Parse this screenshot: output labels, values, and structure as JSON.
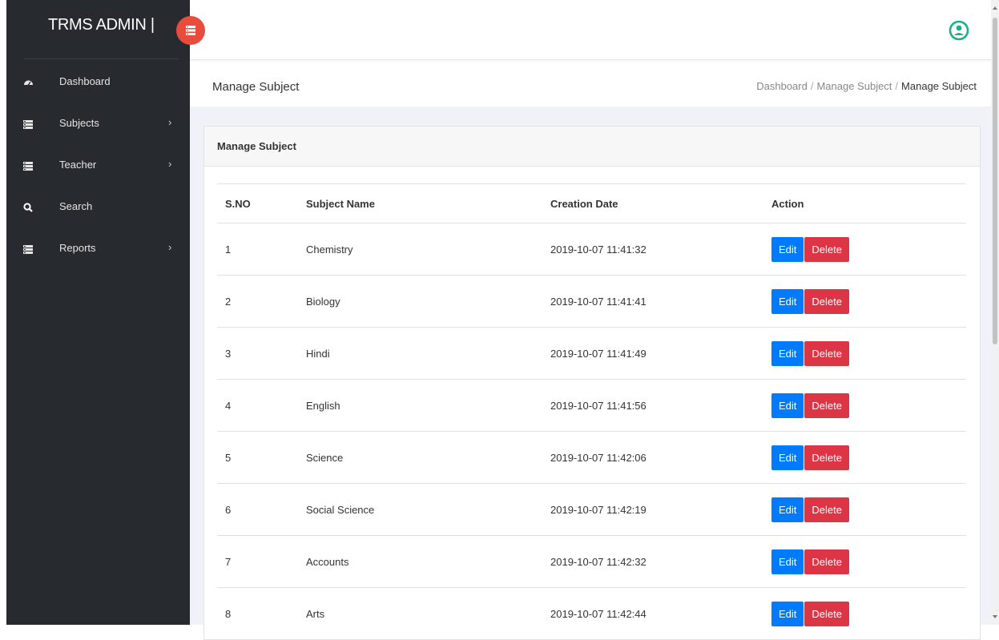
{
  "brand": {
    "title": "TRMS ADMIN |"
  },
  "sidebar": {
    "items": [
      {
        "label": "Dashboard",
        "icon": "dashboard-icon",
        "has_submenu": false
      },
      {
        "label": "Subjects",
        "icon": "list-icon",
        "has_submenu": true
      },
      {
        "label": "Teacher",
        "icon": "list-icon",
        "has_submenu": true
      },
      {
        "label": "Search",
        "icon": "search-icon",
        "has_submenu": false
      },
      {
        "label": "Reports",
        "icon": "list-icon",
        "has_submenu": true
      }
    ]
  },
  "page": {
    "title": "Manage Subject",
    "breadcrumb": [
      "Dashboard",
      "Manage Subject",
      "Manage Subject"
    ]
  },
  "card": {
    "title": "Manage Subject"
  },
  "table": {
    "headers": [
      "S.NO",
      "Subject Name",
      "Creation Date",
      "Action"
    ],
    "rows": [
      {
        "sno": "1",
        "name": "Chemistry",
        "date": "2019-10-07 11:41:32"
      },
      {
        "sno": "2",
        "name": "Biology",
        "date": "2019-10-07 11:41:41"
      },
      {
        "sno": "3",
        "name": "Hindi",
        "date": "2019-10-07 11:41:49"
      },
      {
        "sno": "4",
        "name": "English",
        "date": "2019-10-07 11:41:56"
      },
      {
        "sno": "5",
        "name": "Science",
        "date": "2019-10-07 11:42:06"
      },
      {
        "sno": "6",
        "name": "Social Science",
        "date": "2019-10-07 11:42:19"
      },
      {
        "sno": "7",
        "name": "Accounts",
        "date": "2019-10-07 11:42:32"
      },
      {
        "sno": "8",
        "name": "Arts",
        "date": "2019-10-07 11:42:44"
      }
    ],
    "edit_label": "Edit",
    "delete_label": "Delete"
  },
  "colors": {
    "sidebar_bg": "#272b30",
    "toggle_accent": "#e84c3d",
    "edit_button": "#007bff",
    "delete_button": "#dc3545",
    "user_icon": "#17b38a"
  }
}
